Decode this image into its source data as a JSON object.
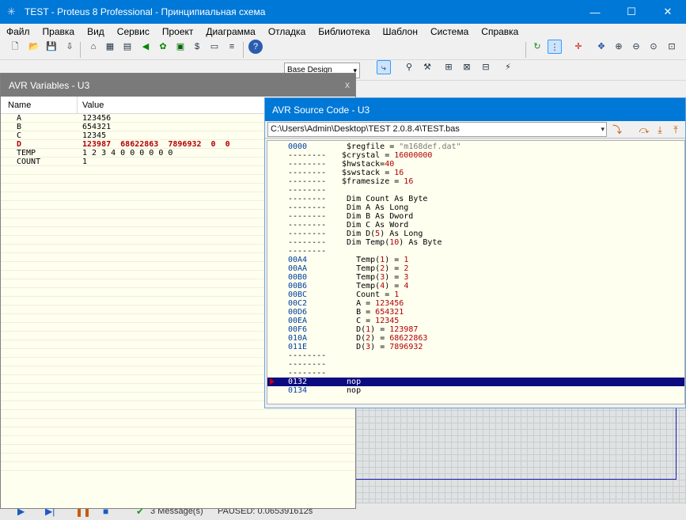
{
  "titlebar": {
    "title": "TEST - Proteus 8 Professional - Принципиальная схема",
    "minimize": "—",
    "maximize": "☐",
    "close": "✕"
  },
  "menu": [
    "Файл",
    "Правка",
    "Вид",
    "Сервис",
    "Проект",
    "Диаграмма",
    "Отладка",
    "Библиотека",
    "Шаблон",
    "Система",
    "Справка"
  ],
  "toolbar": {
    "layer_select": "Base Design"
  },
  "variables_window": {
    "title": "AVR Variables - U3",
    "close": "x",
    "columns": [
      "Name",
      "Value"
    ],
    "rows": [
      {
        "name": "A",
        "value": "123456"
      },
      {
        "name": "B",
        "value": "654321"
      },
      {
        "name": "C",
        "value": "12345"
      },
      {
        "name": "D",
        "value": "123987  68622863  7896932  0  0",
        "highlight": true
      },
      {
        "name": "TEMP",
        "value": "1 2 3 4 0 0 0 0 0 0"
      },
      {
        "name": "COUNT",
        "value": "1"
      }
    ]
  },
  "source_window": {
    "title": "AVR Source Code - U3",
    "path": "C:\\Users\\Admin\\Desktop\\TEST 2.0.8.4\\TEST.bas",
    "lines": [
      {
        "addr": "0000",
        "code": "  $regfile = \"m168def.dat\""
      },
      {
        "addr": "--------",
        "code": " $crystal = 16000000"
      },
      {
        "addr": "--------",
        "code": " $hwstack=40"
      },
      {
        "addr": "--------",
        "code": " $swstack = 16"
      },
      {
        "addr": "--------",
        "code": " $framesize = 16"
      },
      {
        "addr": "--------",
        "code": ""
      },
      {
        "addr": "--------",
        "code": "  Dim Count As Byte"
      },
      {
        "addr": "--------",
        "code": "  Dim A As Long"
      },
      {
        "addr": "--------",
        "code": "  Dim B As Dword"
      },
      {
        "addr": "--------",
        "code": "  Dim C As Word"
      },
      {
        "addr": "--------",
        "code": "  Dim D(5) As Long"
      },
      {
        "addr": "--------",
        "code": "  Dim Temp(10) As Byte"
      },
      {
        "addr": "--------",
        "code": ""
      },
      {
        "addr": "00A4",
        "code": "    Temp(1) = 1"
      },
      {
        "addr": "00AA",
        "code": "    Temp(2) = 2"
      },
      {
        "addr": "00B0",
        "code": "    Temp(3) = 3"
      },
      {
        "addr": "00B6",
        "code": "    Temp(4) = 4"
      },
      {
        "addr": "00BC",
        "code": "    Count = 1"
      },
      {
        "addr": "00C2",
        "code": "    A = 123456"
      },
      {
        "addr": "00D6",
        "code": "    B = 654321"
      },
      {
        "addr": "00EA",
        "code": "    C = 12345"
      },
      {
        "addr": "00F6",
        "code": "    D(1) = 123987"
      },
      {
        "addr": "010A",
        "code": "    D(2) = 68622863"
      },
      {
        "addr": "011E",
        "code": "    D(3) = 7896932"
      },
      {
        "addr": "--------",
        "code": ""
      },
      {
        "addr": "--------",
        "code": ""
      },
      {
        "addr": "--------",
        "code": ""
      },
      {
        "addr": "0132",
        "code": "  nop",
        "current": true
      },
      {
        "addr": "0134",
        "code": "  nop"
      }
    ]
  },
  "status": {
    "messages": "3 Message(s)",
    "sim_status": "PAUSED: 0.065391612s"
  },
  "colors": {
    "titlebar": "#0078d7",
    "inactive_caption": "#7a7a7a",
    "current_line": "#0c0c80",
    "highlight_var": "#b00000"
  }
}
